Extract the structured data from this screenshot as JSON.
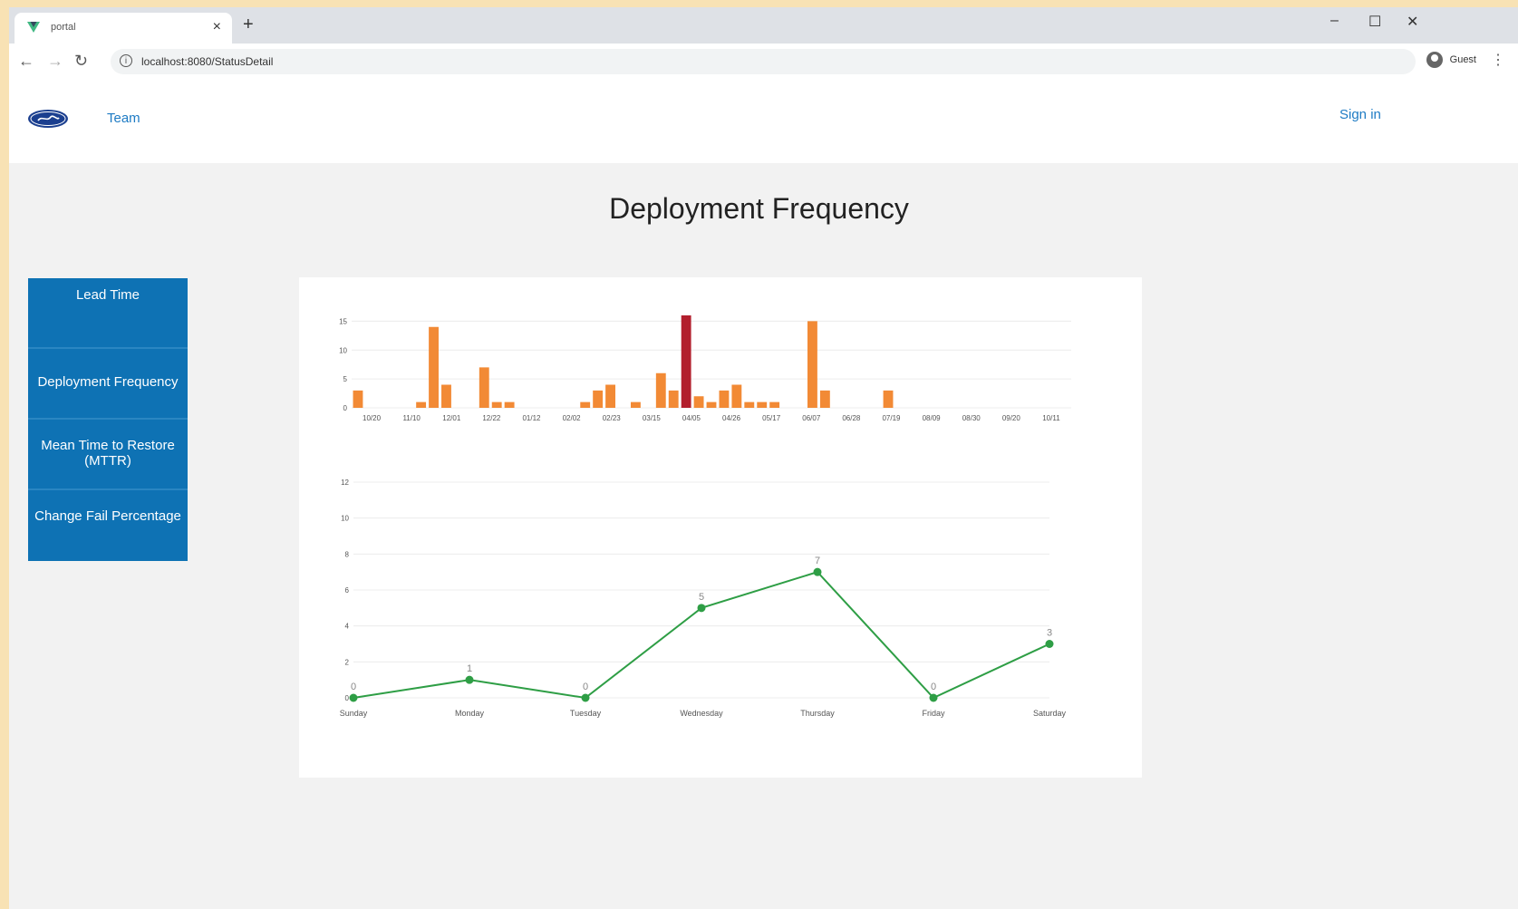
{
  "browser": {
    "tab_title": "portal",
    "url": "localhost:8080/StatusDetail",
    "profile_label": "Guest"
  },
  "header": {
    "team_link": "Team",
    "sign_in": "Sign in"
  },
  "page": {
    "title": "Deployment Frequency"
  },
  "sidebar": {
    "items": [
      {
        "label": "Lead Time"
      },
      {
        "label": "Deployment Frequency"
      },
      {
        "label": "Mean Time to Restore (MTTR)"
      },
      {
        "label": "Change Fail Percentage"
      }
    ]
  },
  "colors": {
    "bar": "#f28a35",
    "bar_highlight": "#b21f2d",
    "line": "#2e9e45",
    "nav_bg": "#0e72b4",
    "link": "#1e7bc4"
  },
  "chart_data": [
    {
      "type": "bar",
      "x_tick_labels": [
        "10/20",
        "11/10",
        "12/01",
        "12/22",
        "01/12",
        "02/02",
        "02/23",
        "03/15",
        "04/05",
        "04/26",
        "05/17",
        "06/07",
        "06/28",
        "07/19",
        "08/09",
        "08/30",
        "09/20",
        "10/11"
      ],
      "values": [
        3,
        0,
        0,
        0,
        0,
        1,
        14,
        4,
        0,
        0,
        7,
        1,
        1,
        0,
        0,
        0,
        0,
        0,
        1,
        3,
        4,
        0,
        1,
        0,
        6,
        3,
        16,
        2,
        1,
        3,
        4,
        1,
        1,
        1,
        0,
        0,
        15,
        3,
        0,
        0,
        0,
        0,
        3,
        0,
        0,
        0,
        0,
        0,
        0,
        0,
        0,
        0,
        0,
        0,
        0,
        0,
        0
      ],
      "highlight_index": 26,
      "y_ticks": [
        0,
        5,
        10,
        15
      ],
      "ylim": [
        0,
        16
      ],
      "grid": true
    },
    {
      "type": "line",
      "categories": [
        "Sunday",
        "Monday",
        "Tuesday",
        "Wednesday",
        "Thursday",
        "Friday",
        "Saturday"
      ],
      "values": [
        0,
        1,
        0,
        5,
        7,
        0,
        3
      ],
      "y_ticks": [
        0,
        2,
        4,
        6,
        8,
        10,
        12
      ],
      "ylim": [
        0,
        12
      ],
      "data_labels": true,
      "grid": true
    }
  ]
}
